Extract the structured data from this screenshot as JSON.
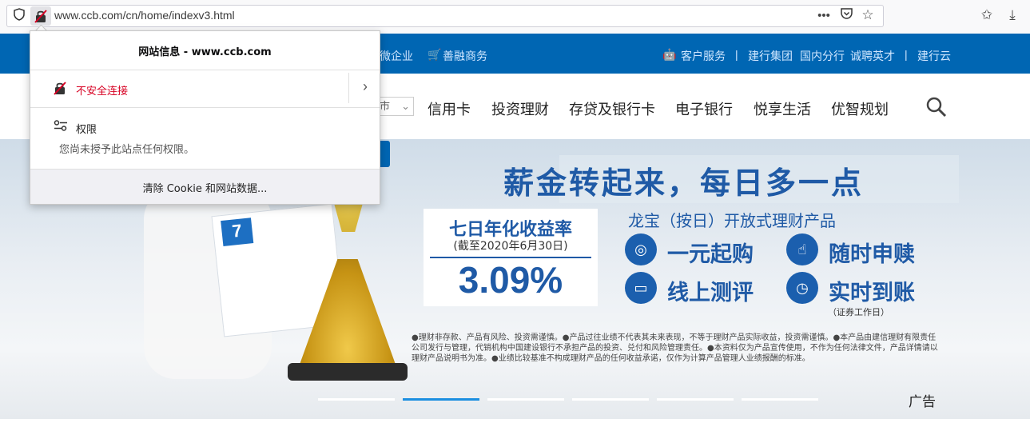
{
  "browser": {
    "url": "www.ccb.com/cn/home/indexv3.html",
    "icons": {
      "shield": "tracking-protection-icon",
      "insecure": "insecure-lock-icon",
      "more": "more-icon",
      "pocket": "pocket-icon",
      "bookmark": "bookmark-star-icon",
      "library": "library-icon",
      "download": "download-icon"
    }
  },
  "site_header": {
    "top_links_left": [
      "微企业",
      "善融商务"
    ],
    "top_links_right": [
      "客户服务",
      "建行集团",
      "国内分行",
      "诚聘英才",
      "建行云"
    ],
    "separator": "|",
    "nav": [
      "信用卡",
      "投资理财",
      "存贷及银行卡",
      "电子银行",
      "悦享生活",
      "优智规划"
    ],
    "city_select_fragment": "市"
  },
  "hero": {
    "headline": "薪金转起来，每日多一点",
    "rate_title": "七日年化收益率",
    "rate_sub": "(截至2020年6月30日)",
    "rate_value": "3.09%",
    "product_name": "龙宝（按日）开放式理财产品",
    "features": [
      "一元起购",
      "随时申赎",
      "线上测评",
      "实时到账"
    ],
    "feature_note": "（证券工作日）",
    "disclaimer": "●理财非存款、产品有风险、投资需谨慎。●产品过往业绩不代表其未来表现，不等于理财产品实际收益，投资需谨慎。●本产品由建信理财有限责任公司发行与管理，代销机构中国建设银行不承担产品的投资、兑付和风险管理责任。●本资料仅为产品宣传使用，不作为任何法律文件，产品详情请以理财产品说明书为准。●业绩比较基准不构成理财产品的任何收益承诺，仅作为计算产品管理人业绩报酬的标准。",
    "calendar_day": "7",
    "ad_label": "广告",
    "slides": 6,
    "active_slide": 2,
    "accent_color": "#1f5aa6"
  },
  "popup": {
    "title": "网站信息 - www.ccb.com",
    "insecure": "不安全连接",
    "permissions_title": "权限",
    "permissions_desc": "您尚未授予此站点任何权限。",
    "clear_button": "清除 Cookie 和网站数据..."
  }
}
